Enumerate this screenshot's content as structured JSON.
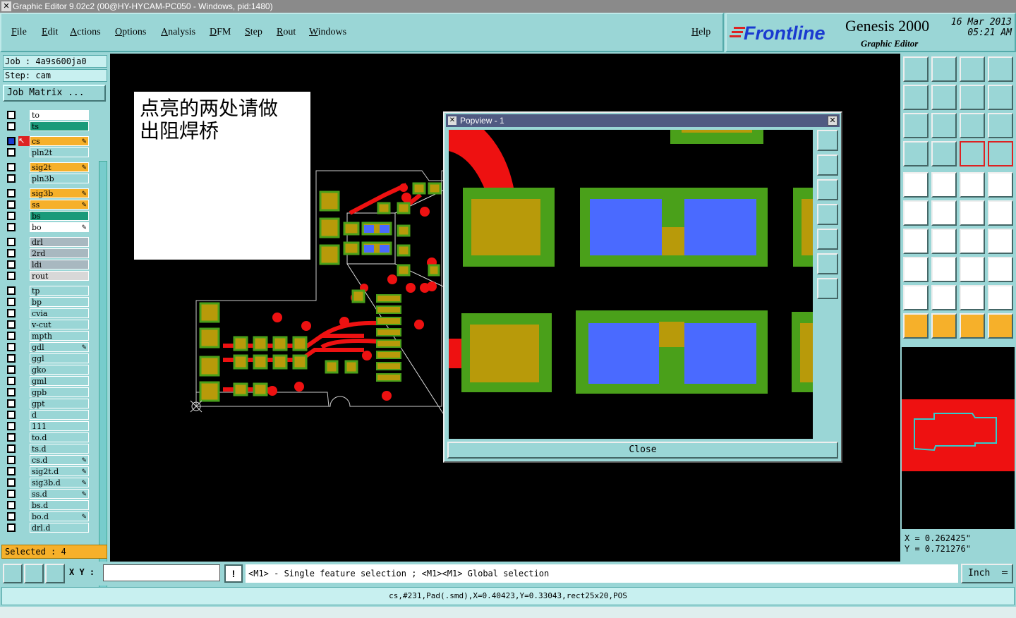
{
  "window": {
    "title": "Graphic Editor 9.02c2 (00@HY-HYCAM-PC050 - Windows, pid:1480)"
  },
  "menu": [
    "File",
    "Edit",
    "Actions",
    "Options",
    "Analysis",
    "DFM",
    "Step",
    "Rout",
    "Windows"
  ],
  "help_label": "Help",
  "brand": {
    "logo": "Frontline",
    "product": "Genesis 2000",
    "subtitle": "Graphic Editor",
    "date": "16 Mar 2013",
    "time": "05:21 AM"
  },
  "job": {
    "job_label": "Job : 4a9s600ja0",
    "step_label": "Step: cam",
    "matrix_button": "Job Matrix ..."
  },
  "layers": [
    {
      "name": "to",
      "color": "#ffffff",
      "editable": false
    },
    {
      "name": "ts",
      "color": "#1a9a7a",
      "editable": false
    },
    {
      "name": "cs",
      "color": "#f6b02a",
      "editable": true,
      "work": true
    },
    {
      "name": "pln2t",
      "color": "#9ad6d6",
      "editable": false
    },
    {
      "name": "sig2t",
      "color": "#f6b02a",
      "editable": true
    },
    {
      "name": "pln3b",
      "color": "#9ad6d6",
      "editable": false
    },
    {
      "name": "sig3b",
      "color": "#f6b02a",
      "editable": true
    },
    {
      "name": "ss",
      "color": "#f6b02a",
      "editable": true
    },
    {
      "name": "bs",
      "color": "#1a9a7a",
      "editable": false
    },
    {
      "name": "bo",
      "color": "#ffffff",
      "editable": true
    },
    {
      "name": "drl",
      "color": "#a8b8c0",
      "editable": false
    },
    {
      "name": "2rd",
      "color": "#a8b8c0",
      "editable": false
    },
    {
      "name": "ldi",
      "color": "#a8b8c0",
      "editable": false
    },
    {
      "name": "rout",
      "color": "#d8d8d8",
      "editable": false
    },
    {
      "name": "tp",
      "color": "#9ad6d6",
      "editable": false
    },
    {
      "name": "bp",
      "color": "#9ad6d6",
      "editable": false
    },
    {
      "name": "cvia",
      "color": "#9ad6d6",
      "editable": false
    },
    {
      "name": "v-cut",
      "color": "#9ad6d6",
      "editable": false
    },
    {
      "name": "mpth",
      "color": "#9ad6d6",
      "editable": false
    },
    {
      "name": "gdl",
      "color": "#9ad6d6",
      "editable": true
    },
    {
      "name": "ggl",
      "color": "#9ad6d6",
      "editable": false
    },
    {
      "name": "gko",
      "color": "#9ad6d6",
      "editable": false
    },
    {
      "name": "gml",
      "color": "#9ad6d6",
      "editable": false
    },
    {
      "name": "gpb",
      "color": "#9ad6d6",
      "editable": false
    },
    {
      "name": "gpt",
      "color": "#9ad6d6",
      "editable": false
    },
    {
      "name": "d",
      "color": "#9ad6d6",
      "editable": false
    },
    {
      "name": "111",
      "color": "#9ad6d6",
      "editable": false
    },
    {
      "name": "to.d",
      "color": "#9ad6d6",
      "editable": false
    },
    {
      "name": "ts.d",
      "color": "#9ad6d6",
      "editable": false
    },
    {
      "name": "cs.d",
      "color": "#9ad6d6",
      "editable": true
    },
    {
      "name": "sig2t.d",
      "color": "#9ad6d6",
      "editable": true
    },
    {
      "name": "sig3b.d",
      "color": "#9ad6d6",
      "editable": true
    },
    {
      "name": "ss.d",
      "color": "#9ad6d6",
      "editable": true
    },
    {
      "name": "bs.d",
      "color": "#9ad6d6",
      "editable": false
    },
    {
      "name": "bo.d",
      "color": "#9ad6d6",
      "editable": true
    },
    {
      "name": "drl.d",
      "color": "#9ad6d6",
      "editable": false
    }
  ],
  "selected_label": "Selected : 4",
  "annotation": {
    "line1": "点亮的两处请做",
    "line2": "出阻焊桥"
  },
  "popview": {
    "title": "Popview - 1",
    "close_label": "Close"
  },
  "coords": {
    "x": "X = 0.262425\"",
    "y": "Y = 0.721276\""
  },
  "bottom": {
    "xy_label": "X Y :",
    "xy_value": "",
    "help": "<M1> - Single feature selection ; <M1><M1> Global selection",
    "units": "Inch",
    "status": "cs,#231,Pad(.smd),X=0.40423,Y=0.33043,rect25x20,POS"
  },
  "colors": {
    "pad": "#b89a0a",
    "mask": "#4aa01a",
    "copper": "#ee1111",
    "highlight": "#4a6aff",
    "bg": "#9ad6d6"
  }
}
